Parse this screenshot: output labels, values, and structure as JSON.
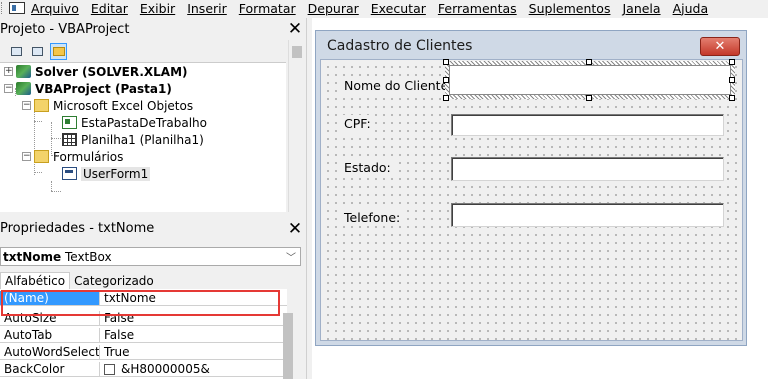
{
  "menu": {
    "items": [
      "Arquivo",
      "Editar",
      "Exibir",
      "Inserir",
      "Formatar",
      "Depurar",
      "Executar",
      "Ferramentas",
      "Suplementos",
      "Janela",
      "Ajuda"
    ]
  },
  "project_panel": {
    "title": "Projeto - VBAProject",
    "close": "✕",
    "tree": {
      "solver": "Solver (SOLVER.XLAM)",
      "vbaproject": "VBAProject (Pasta1)",
      "excel_objects": "Microsoft Excel Objetos",
      "workbook": "EstaPastaDeTrabalho",
      "sheet": "Planilha1 (Planilha1)",
      "forms": "Formulários",
      "userform": "UserForm1"
    }
  },
  "properties_panel": {
    "title": "Propriedades - txtNome",
    "close": "✕",
    "object_name": "txtNome",
    "object_type": "TextBox",
    "tabs": [
      "Alfabético",
      "Categorizado"
    ],
    "rows": [
      {
        "name": "(Name)",
        "value": "txtNome"
      },
      {
        "name": "AutoSize",
        "value": "False"
      },
      {
        "name": "AutoTab",
        "value": "False"
      },
      {
        "name": "AutoWordSelect",
        "value": "True"
      },
      {
        "name": "BackColor",
        "value": "&H80000005&"
      }
    ]
  },
  "userform": {
    "caption": "Cadastro de Clientes",
    "close": "✕",
    "labels": {
      "nome": "Nome do Cliente:",
      "cpf": "CPF:",
      "estado": "Estado:",
      "telefone": "Telefone:"
    }
  },
  "colors": {
    "selection_highlight": "#e53935",
    "selected_property": "#3399ff",
    "close_button": "#c3382a"
  }
}
